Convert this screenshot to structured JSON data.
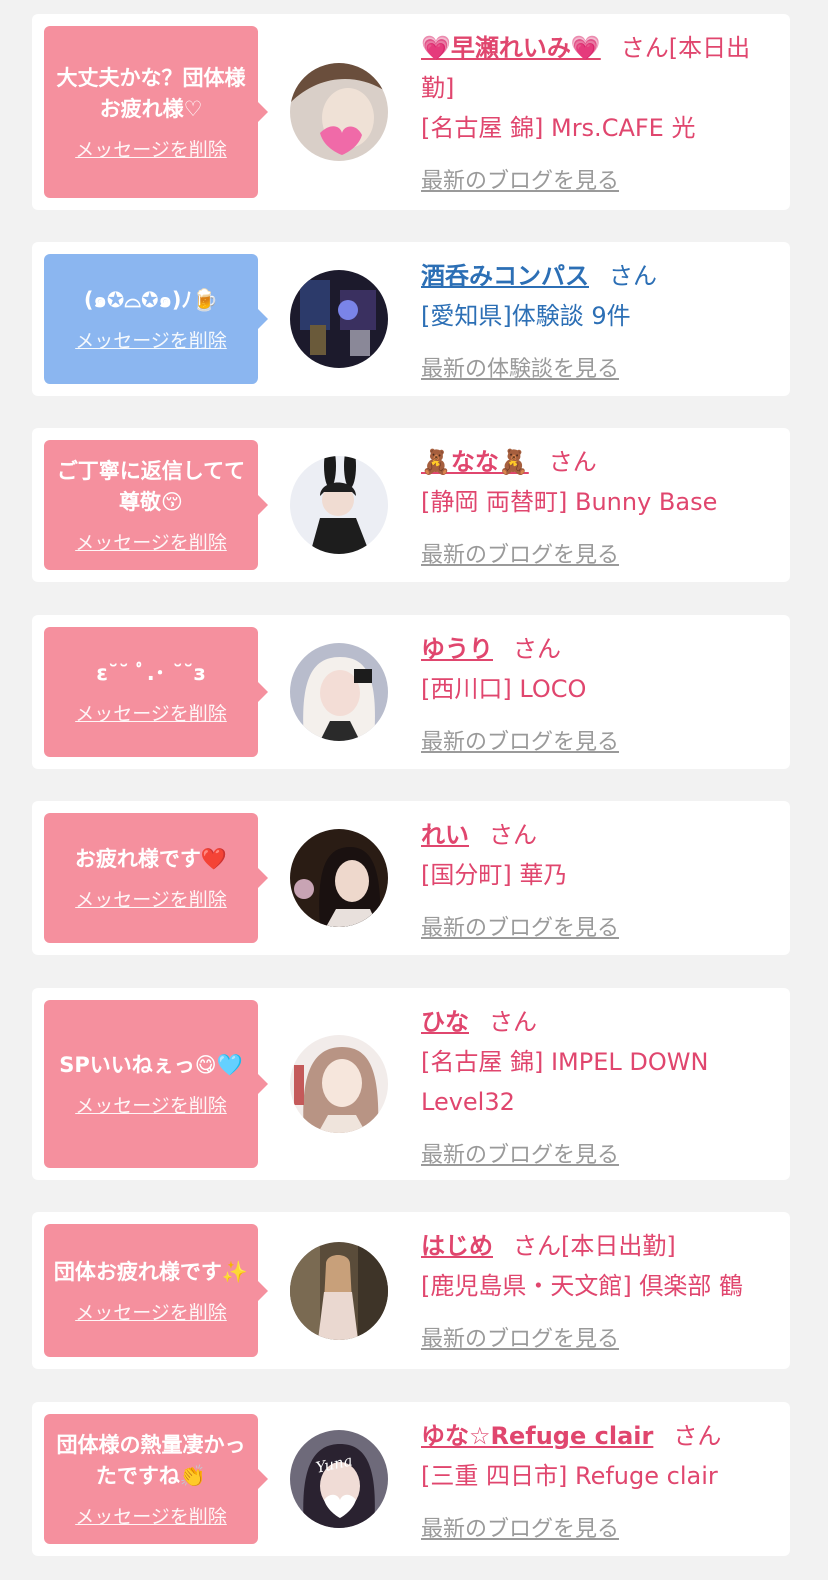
{
  "delete_label": "メッセージを削除",
  "colors": {
    "pink_bubble": "#f5909e",
    "blue_bubble": "#8bb6f0",
    "pink_text": "#e0466e",
    "blue_text": "#2c6fb5",
    "link_gray": "#9a9a9a",
    "page_bg": "#f2f2f2"
  },
  "cards": [
    {
      "message": "大丈夫かな？団体様お疲れ様♡",
      "name": "💗早瀬れいみ💗",
      "suffix": "さん[本日出勤]",
      "location": "[名古屋 錦] Mrs.CAFE 光",
      "link": "最新のブログを見る"
    },
    {
      "message": "(๑✪︎⌓︎✪︎๑)ﾉ🍺",
      "name": "酒呑みコンパス",
      "suffix": "さん",
      "location": "[愛知県]体験談 9件",
      "link": "最新の体験談を見る"
    },
    {
      "message": "ご丁寧に返信してて尊敬😚",
      "name": "🧸なな🧸",
      "suffix": "さん",
      "location": "[静岡 両替町] Bunny Base",
      "link": "最新のブログを見る"
    },
    {
      "message": "ε˘˘ ﾟ.･ ˘˘з",
      "name": "ゆうり",
      "suffix": "さん",
      "location": "[西川口] LOCO",
      "link": "最新のブログを見る"
    },
    {
      "message": "お疲れ様です❤️",
      "name": "れい",
      "suffix": "さん",
      "location": "[国分町] 華乃",
      "link": "最新のブログを見る"
    },
    {
      "message": "SPいいねぇっ😋🩵",
      "name": "ひな",
      "suffix": "さん",
      "location": "[名古屋 錦] IMPEL DOWN Level32",
      "link": "最新のブログを見る"
    },
    {
      "message": "団体お疲れ様です✨",
      "name": "はじめ",
      "suffix": "さん[本日出勤]",
      "location": "[鹿児島県・天文館] 倶楽部 鶴",
      "link": "最新のブログを見る"
    },
    {
      "message": "団体様の熱量凄かったですね👏",
      "name": "ゆな☆Refuge clair",
      "suffix": "さん",
      "location": "[三重 四日市] Refuge clair",
      "link": "最新のブログを見る",
      "avatar_text": "Yuna"
    }
  ]
}
